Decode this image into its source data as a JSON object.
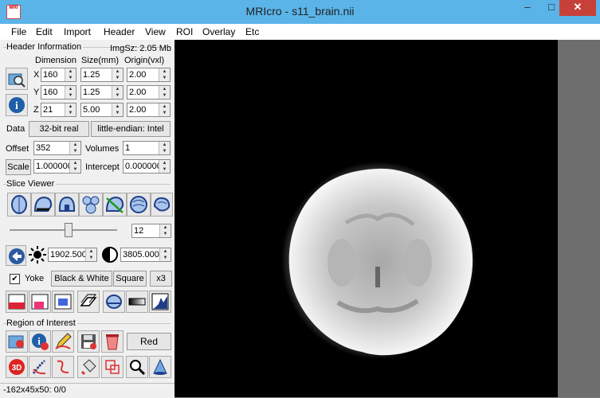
{
  "window": {
    "title": "MRIcro - s11_brain.nii",
    "icon_text": "MRI"
  },
  "menu": [
    "File",
    "Edit",
    "Import",
    "Header",
    "View",
    "ROI",
    "Overlay",
    "Etc"
  ],
  "header_info": {
    "group_label": "Header Information",
    "img_size": "ImgSz: 2.05 Mb",
    "col_dimension": "Dimension",
    "col_size": "Size(mm)",
    "col_origin": "Origin(vxl)",
    "rows": [
      {
        "axis": "X",
        "dim": "160",
        "size": "1.25",
        "origin": "2.00"
      },
      {
        "axis": "Y",
        "dim": "160",
        "size": "1.25",
        "origin": "2.00"
      },
      {
        "axis": "Z",
        "dim": "21",
        "size": "5.00",
        "origin": "2.00"
      }
    ],
    "data_label": "Data",
    "data_type": "32-bit real",
    "endian": "little-endian: Intel",
    "offset_label": "Offset",
    "offset": "352",
    "volumes_label": "Volumes",
    "volumes": "1",
    "scale_label": "Scale",
    "scale": "1.000000",
    "intercept_label": "Intercept",
    "intercept": "0.000000"
  },
  "slice_viewer": {
    "group_label": "Slice Viewer",
    "slice": "12",
    "slider_fraction": 0.55,
    "brightness": "1902.500",
    "contrast": "3805.000",
    "yoke_label": "Yoke",
    "yoke_checked": true,
    "colormap": "Black & White",
    "square": "Square",
    "zoom": "x3"
  },
  "roi": {
    "group_label": "Region of Interest",
    "color_button": "Red"
  },
  "status": "-162x45x50: 0/0",
  "colors": {
    "titlebar": "#5ab4e8",
    "close": "#c7413a",
    "panel": "#f0f0f0"
  }
}
